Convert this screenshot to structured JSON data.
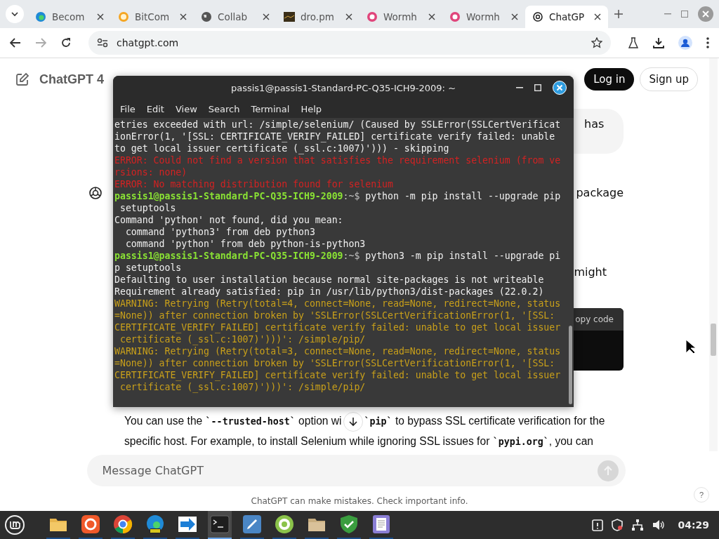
{
  "browser": {
    "tabs": [
      {
        "title": "Becom",
        "kind": "edge",
        "selected": false
      },
      {
        "title": "BitCom",
        "kind": "bitcomet",
        "selected": false
      },
      {
        "title": "Collab",
        "kind": "globe",
        "selected": false
      },
      {
        "title": "dro.pm",
        "kind": "thumbnail",
        "selected": false
      },
      {
        "title": "Wormh",
        "kind": "wormhole",
        "selected": false
      },
      {
        "title": "Wormh",
        "kind": "wormhole",
        "selected": false
      },
      {
        "title": "ChatGP",
        "kind": "chatgpt",
        "selected": true
      }
    ],
    "address": "chatgpt.com"
  },
  "page": {
    "model": "ChatGPT 4",
    "login": "Log in",
    "signup": "Sign up",
    "user_fragment": "has",
    "fragment_1": "package",
    "fragment_2": "might",
    "copy_code": "opy code",
    "line_1_start": [
      {
        "kind": "text",
        "text": "You can use the "
      },
      {
        "kind": "code",
        "text": "`--trusted-host`"
      },
      {
        "kind": "text",
        "text": " option wi"
      }
    ],
    "line_1_end": [
      {
        "kind": "code",
        "text": "`pip`"
      },
      {
        "kind": "text",
        "text": " to bypass SSL certificate verification for the"
      }
    ],
    "line_2": [
      {
        "kind": "text",
        "text": "specific host. For example, to install Selenium while ignoring SSL issues for "
      },
      {
        "kind": "code",
        "text": "`pypi.org`"
      },
      {
        "kind": "text",
        "text": ", you can"
      }
    ],
    "message_placeholder": "Message ChatGPT",
    "disclaimer": "ChatGPT can make mistakes. Check important info.",
    "help": "?"
  },
  "terminal": {
    "title": "passis1@passis1-Standard-PC-Q35-ICH9-2009: ~",
    "menu": [
      "File",
      "Edit",
      "View",
      "Search",
      "Terminal",
      "Help"
    ],
    "lines": [
      {
        "kind": "output",
        "text": "etries exceeded with url: /simple/selenium/ (Caused by SSLError(SSLCertVerificat"
      },
      {
        "kind": "output",
        "text": "ionError(1, '[SSL: CERTIFICATE_VERIFY_FAILED] certificate verify failed: unable"
      },
      {
        "kind": "output",
        "text": "to get local issuer certificate (_ssl.c:1007)'))) - skipping"
      },
      {
        "kind": "error",
        "text": "ERROR: Could not find a version that satisfies the requirement selenium (from ve"
      },
      {
        "kind": "error",
        "text": "rsions: none)"
      },
      {
        "kind": "error",
        "text": "ERROR: No matching distribution found for selenium"
      },
      {
        "kind": "prompt",
        "user": "passis1@passis1-Standard-PC-Q35-ICH9-2009",
        "path": ":~$",
        "text": " python -m pip install --upgrade pip"
      },
      {
        "kind": "output",
        "text": " setuptools"
      },
      {
        "kind": "output",
        "text": "Command 'python' not found, did you mean:"
      },
      {
        "kind": "output",
        "text": "  command 'python3' from deb python3"
      },
      {
        "kind": "output",
        "text": "  command 'python' from deb python-is-python3"
      },
      {
        "kind": "prompt",
        "user": "passis1@passis1-Standard-PC-Q35-ICH9-2009",
        "path": ":~$",
        "text": " python3 -m pip install --upgrade pi"
      },
      {
        "kind": "output",
        "text": "p setuptools"
      },
      {
        "kind": "output",
        "text": "Defaulting to user installation because normal site-packages is not writeable"
      },
      {
        "kind": "output",
        "text": "Requirement already satisfied: pip in /usr/lib/python3/dist-packages (22.0.2)"
      },
      {
        "kind": "warning",
        "text": "WARNING: Retrying (Retry(total=4, connect=None, read=None, redirect=None, status"
      },
      {
        "kind": "warning",
        "text": "=None)) after connection broken by 'SSLError(SSLCertVerificationError(1, '[SSL:"
      },
      {
        "kind": "warning",
        "text": "CERTIFICATE_VERIFY_FAILED] certificate verify failed: unable to get local issuer"
      },
      {
        "kind": "warning",
        "text": " certificate (_ssl.c:1007)')))': /simple/pip/"
      },
      {
        "kind": "warning",
        "text": "WARNING: Retrying (Retry(total=3, connect=None, read=None, redirect=None, status"
      },
      {
        "kind": "warning",
        "text": "=None)) after connection broken by 'SSLError(SSLCertVerificationError(1, '[SSL:"
      },
      {
        "kind": "warning",
        "text": "CERTIFICATE_VERIFY_FAILED] certificate verify failed: unable to get local issuer"
      },
      {
        "kind": "warning",
        "text": " certificate (_ssl.c:1007)')))': /simple/pip/"
      }
    ]
  },
  "taskbar": {
    "apps": [
      {
        "kind": "folder",
        "selected": false
      },
      {
        "kind": "firefox",
        "selected": false
      },
      {
        "kind": "chrome",
        "selected": false
      },
      {
        "kind": "edge",
        "selected": false
      },
      {
        "kind": "transfer",
        "selected": false
      },
      {
        "kind": "terminal",
        "selected": true
      },
      {
        "kind": "editor",
        "selected": false
      },
      {
        "kind": "grid",
        "selected": false
      },
      {
        "kind": "box",
        "selected": false
      },
      {
        "kind": "shield",
        "selected": false
      },
      {
        "kind": "notes",
        "selected": false
      }
    ],
    "clock": "04:29"
  }
}
